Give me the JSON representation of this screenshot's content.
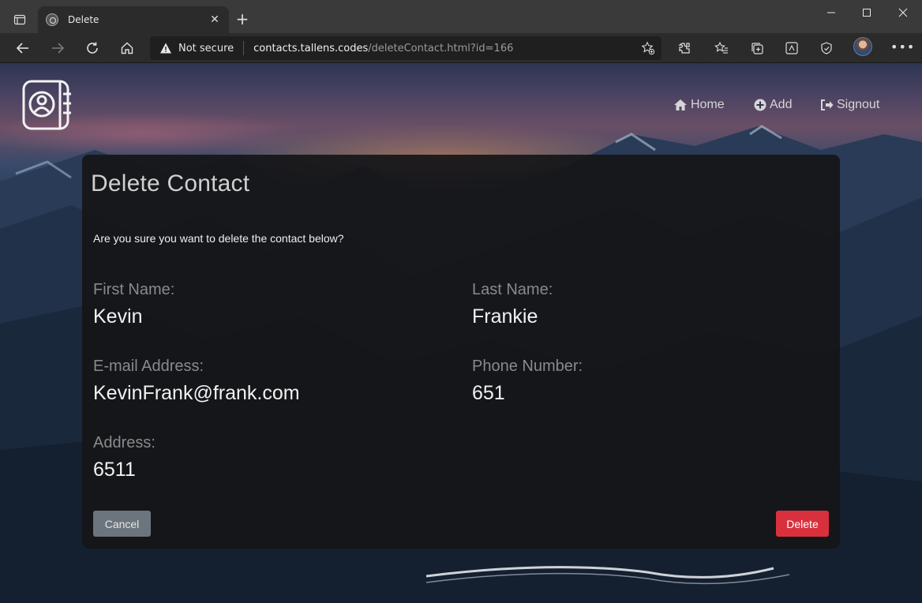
{
  "browser": {
    "tab_title": "Delete",
    "security_label": "Not secure",
    "url_host": "contacts.tallens.codes",
    "url_path": "/deleteContact.html?id=166"
  },
  "nav": {
    "home": "Home",
    "add": "Add",
    "signout": "Signout"
  },
  "card": {
    "title": "Delete Contact",
    "question": "Are you sure you want to delete the contact below?",
    "fields": {
      "first_name": {
        "label": "First Name:",
        "value": "Kevin"
      },
      "last_name": {
        "label": "Last Name:",
        "value": "Frankie"
      },
      "email": {
        "label": "E-mail Address:",
        "value": "KevinFrank@frank.com"
      },
      "phone": {
        "label": "Phone Number:",
        "value": "651"
      },
      "address": {
        "label": "Address:",
        "value": "6511"
      }
    },
    "cancel_label": "Cancel",
    "delete_label": "Delete"
  },
  "colors": {
    "delete_button": "#d9303e",
    "cancel_button": "#6c757d"
  }
}
